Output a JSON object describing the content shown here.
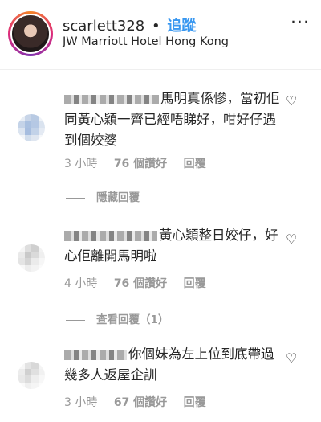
{
  "header": {
    "username": "scarlett328",
    "separator": "•",
    "follow_label": "追蹤",
    "location": "JW Marriott Hotel Hong Kong",
    "more_label": "···"
  },
  "comments": [
    {
      "text": "馬明真係慘，當初佢同黃心穎一齊已經唔睇好，咁好仔遇到個姣婆",
      "time": "3 小時",
      "likes": "76 個讚好",
      "reply": "回覆",
      "thread_label": "隱藏回覆",
      "avatar_colors": [
        "#d8e1ee",
        "#c9d6e8",
        "#b7c9e3",
        "#e5ebf3"
      ]
    },
    {
      "text": "黃心穎整日姣仔，好心佢離開馬明啦",
      "time": "4 小時",
      "likes": "76 個讚好",
      "reply": "回覆",
      "thread_label": "查看回覆（1）",
      "avatar_colors": [
        "#e3e3e3",
        "#f0f0f0",
        "#d3d3d3",
        "#ececec"
      ]
    },
    {
      "text": "你個妹為左上位到底帶過幾多人返屋企訓",
      "time": "3 小時",
      "likes": "67 個讚好",
      "reply": "回覆",
      "avatar_colors": [
        "#e8e8e8",
        "#d6d6d6",
        "#efefef",
        "#dcdcdc"
      ]
    }
  ],
  "icons": {
    "heart": "♡"
  }
}
